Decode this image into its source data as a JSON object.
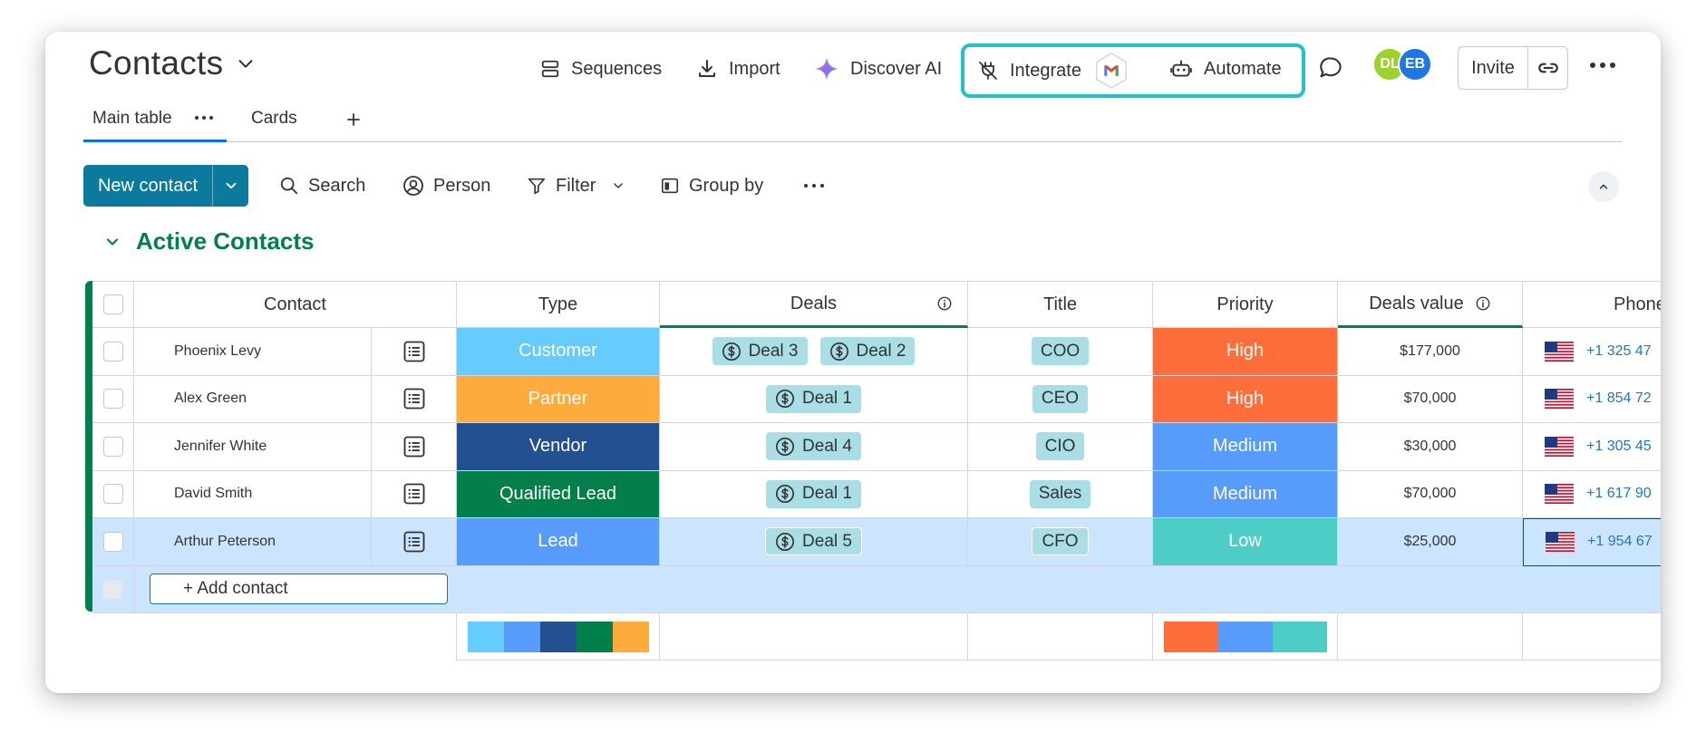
{
  "board": {
    "title": "Contacts"
  },
  "header": {
    "sequences": "Sequences",
    "import": "Import",
    "discover_ai": "Discover AI",
    "integrate": "Integrate",
    "automate": "Automate",
    "avatars": [
      {
        "initials": "DL",
        "color": "#9cd326"
      },
      {
        "initials": "EB",
        "color": "#1f76e6"
      }
    ],
    "invite": "Invite"
  },
  "tabs": [
    {
      "label": "Main table",
      "active": true
    },
    {
      "label": "Cards",
      "active": false
    }
  ],
  "toolbar": {
    "new_contact": "New contact",
    "search": "Search",
    "person": "Person",
    "filter": "Filter",
    "group_by": "Group by"
  },
  "group": {
    "title": "Active Contacts",
    "color": "#037f4c"
  },
  "columns": {
    "contact": "Contact",
    "type": "Type",
    "deals": "Deals",
    "title": "Title",
    "priority": "Priority",
    "deals_value": "Deals value",
    "phone": "Phone"
  },
  "rows": [
    {
      "name": "Phoenix Levy",
      "type": "Customer",
      "type_color": "#66ccff",
      "deals": [
        "Deal 3",
        "Deal 2"
      ],
      "title": "COO",
      "priority": "High",
      "priority_color": "#ff6d3b",
      "value": "$177,000",
      "phone": "+1 325 47"
    },
    {
      "name": "Alex Green",
      "type": "Partner",
      "type_color": "#fdab3d",
      "deals": [
        "Deal 1"
      ],
      "title": "CEO",
      "priority": "High",
      "priority_color": "#ff6d3b",
      "value": "$70,000",
      "phone": "+1 854 72"
    },
    {
      "name": "Jennifer White",
      "type": "Vendor",
      "type_color": "#225091",
      "deals": [
        "Deal 4"
      ],
      "title": "CIO",
      "priority": "Medium",
      "priority_color": "#579bfc",
      "value": "$30,000",
      "phone": "+1 305 45"
    },
    {
      "name": "David Smith",
      "type": "Qualified Lead",
      "type_color": "#037f4c",
      "deals": [
        "Deal 1"
      ],
      "title": "Sales",
      "priority": "Medium",
      "priority_color": "#579bfc",
      "value": "$70,000",
      "phone": "+1 617 90"
    },
    {
      "name": "Arthur Peterson",
      "type": "Lead",
      "type_color": "#579bfc",
      "deals": [
        "Deal 5"
      ],
      "title": "CFO",
      "priority": "Low",
      "priority_color": "#4eccc6",
      "value": "$25,000",
      "phone": "+1 954 67"
    }
  ],
  "add_contact": "+ Add contact",
  "summary": {
    "type_colors": [
      "#66ccff",
      "#579bfc",
      "#225091",
      "#037f4c",
      "#fdab3d"
    ],
    "priority_colors": [
      "#ff6d3b",
      "#579bfc",
      "#4eccc6"
    ]
  }
}
